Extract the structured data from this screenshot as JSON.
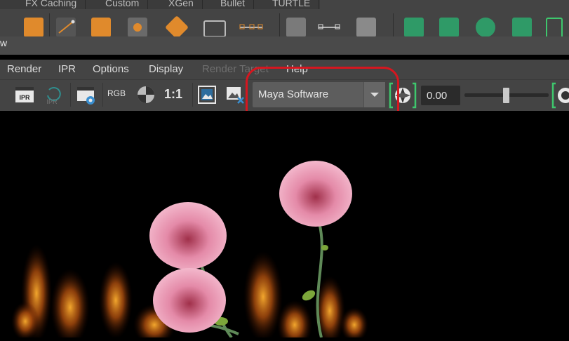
{
  "shelf": {
    "tabs": [
      "FX Caching",
      "Custom",
      "XGen",
      "Bullet",
      "TURTLE"
    ]
  },
  "window": {
    "title": "w"
  },
  "menu": {
    "items": [
      {
        "label": "Render",
        "enabled": true
      },
      {
        "label": "IPR",
        "enabled": true
      },
      {
        "label": "Options",
        "enabled": true
      },
      {
        "label": "Display",
        "enabled": true
      },
      {
        "label": "Render Target",
        "enabled": false
      },
      {
        "label": "Help",
        "enabled": true
      }
    ]
  },
  "toolbar": {
    "render_icon_label": "IPR",
    "ipr_icon_label": "IPR",
    "rgb_label": "RGB",
    "ratio_label": "1:1",
    "renderer": "Maya Software",
    "exposure_value": "0.00"
  },
  "colors": {
    "highlight": "#d6161f",
    "accent_green": "#3ec76d"
  }
}
